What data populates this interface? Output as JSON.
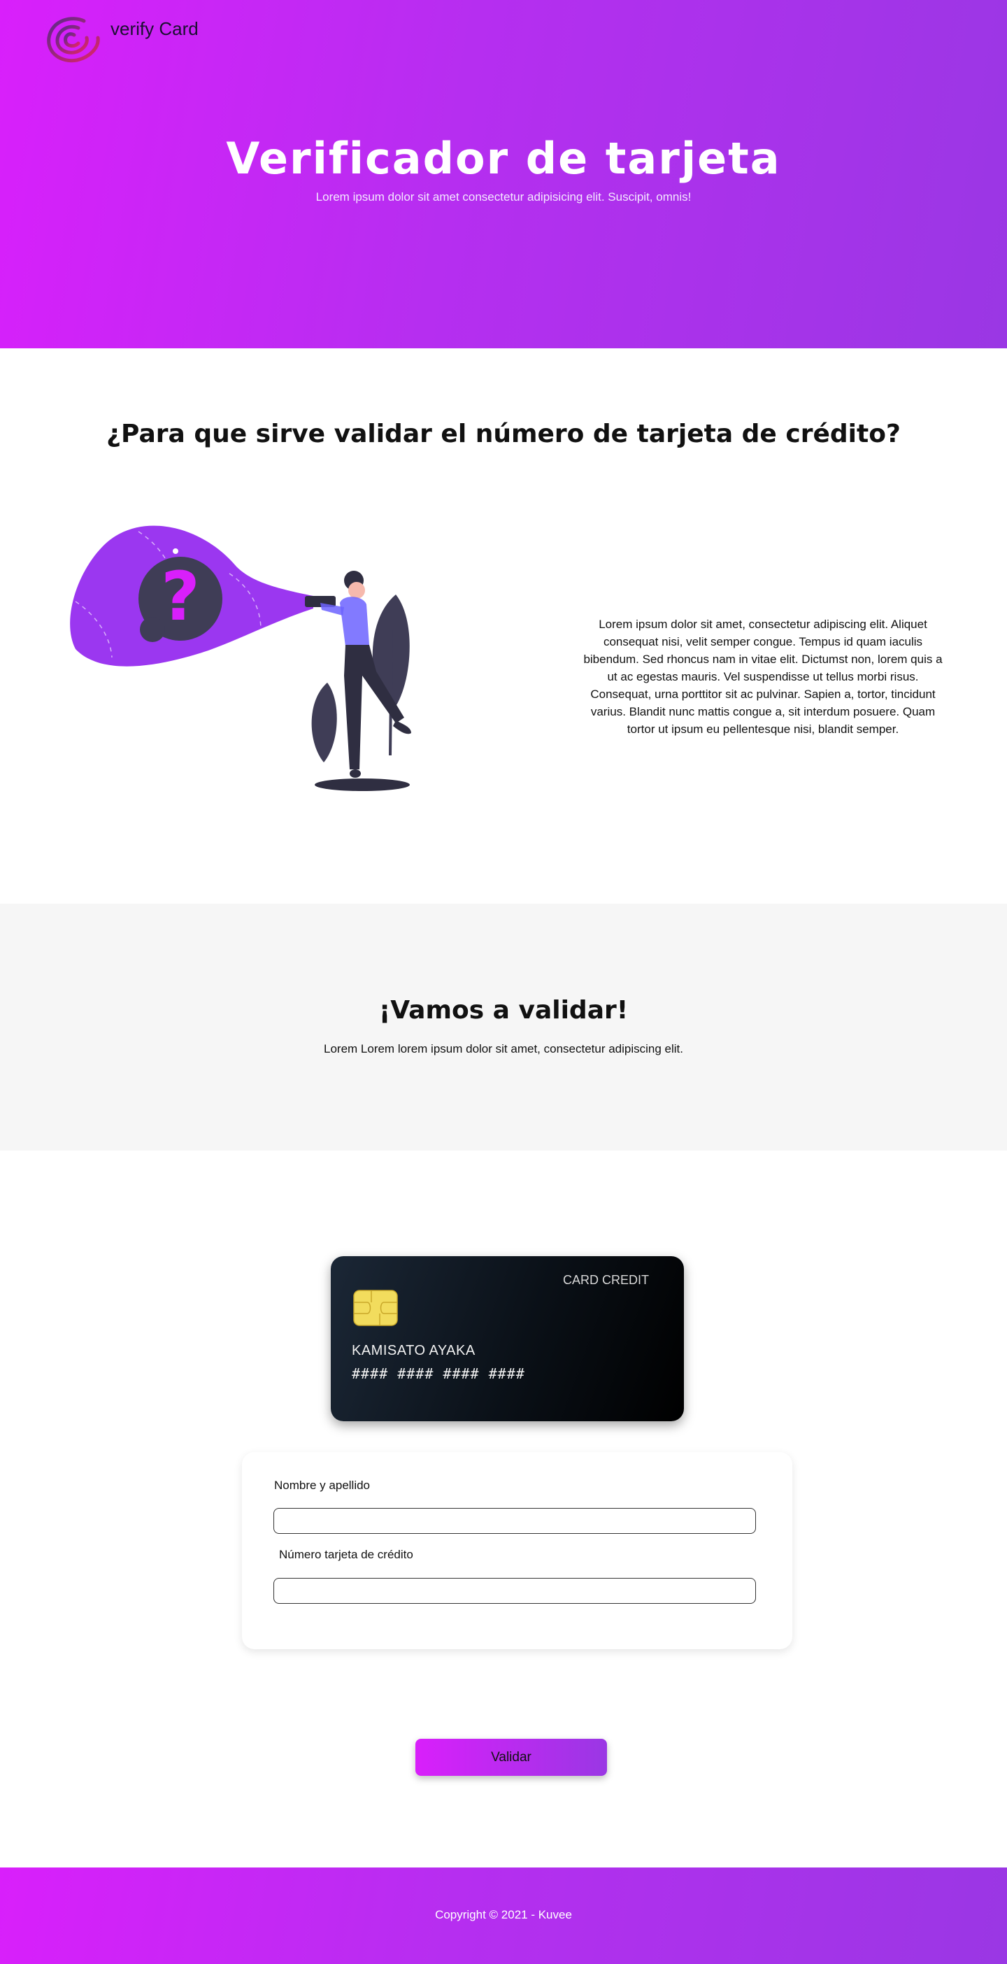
{
  "header": {
    "brand": "verify Card",
    "title": "Verificador de tarjeta",
    "subtitle": "Lorem ipsum dolor sit amet consectetur adipisicing elit. Suscipit, omnis!"
  },
  "info": {
    "title": "¿Para que sirve validar el número de tarjeta de crédito?",
    "text": "Lorem ipsum dolor sit amet, consectetur adipiscing elit. Aliquet consequat nisi, velit semper congue. Tempus id quam iaculis bibendum. Sed rhoncus nam in vitae elit. Dictumst non, lorem quis a ut ac egestas mauris. Vel suspendisse ut tellus morbi risus. Consequat, urna porttitor sit ac pulvinar. Sapien a, tortor, tincidunt varius. Blandit nunc mattis congue a, sit interdum posuere. Quam tortor ut ipsum eu pellentesque nisi, blandit semper."
  },
  "cta": {
    "title": "¡Vamos a validar!",
    "subtitle": "Lorem Lorem lorem ipsum dolor sit amet, consectetur adipiscing elit."
  },
  "card": {
    "type": "CARD CREDIT",
    "holder": "KAMISATO AYAKA",
    "number": "#### #### #### ####"
  },
  "form": {
    "name_label": "Nombre y apellido",
    "name_value": "",
    "card_label": "Número tarjeta de crédito",
    "card_value": "",
    "submit_label": "Validar"
  },
  "footer": {
    "copyright": "Copyright © 2021 - Kuvee"
  },
  "colors": {
    "gradient_start": "#d91ffb",
    "gradient_end": "#9a37e4",
    "section_bg": "#f6f6f6",
    "card_bg": "#0a1017"
  }
}
